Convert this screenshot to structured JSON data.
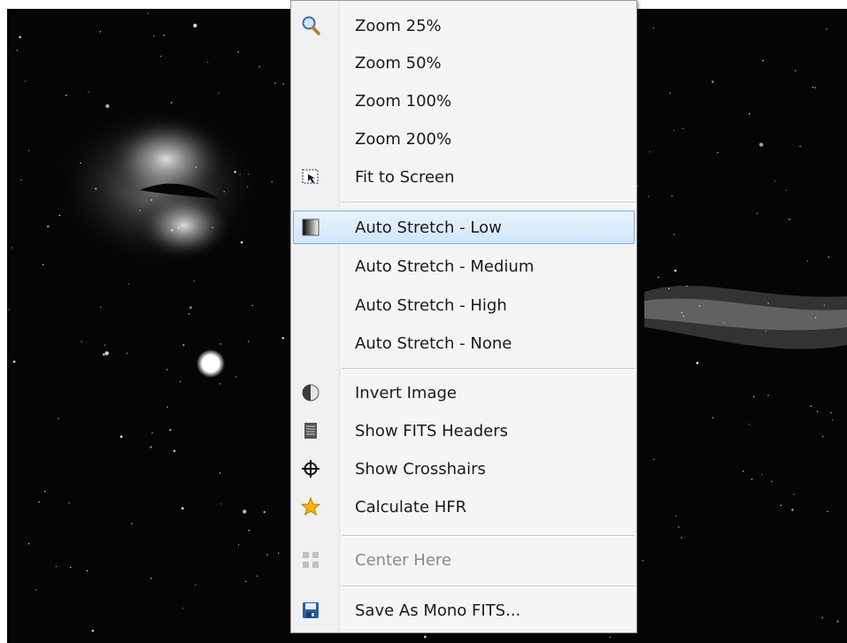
{
  "menu": {
    "items": [
      {
        "label": "Zoom 25%",
        "icon": "magnifier-icon"
      },
      {
        "label": "Zoom 50%",
        "icon": ""
      },
      {
        "label": "Zoom 100%",
        "icon": ""
      },
      {
        "label": "Zoom 200%",
        "icon": ""
      },
      {
        "label": "Fit to Screen",
        "icon": "fit-to-screen-icon"
      },
      {
        "label": "Auto Stretch - Low",
        "icon": "gradient-icon",
        "highlighted": true
      },
      {
        "label": "Auto Stretch - Medium",
        "icon": ""
      },
      {
        "label": "Auto Stretch - High",
        "icon": ""
      },
      {
        "label": "Auto Stretch - None",
        "icon": ""
      },
      {
        "label": "Invert Image",
        "icon": "half-circle-icon"
      },
      {
        "label": "Show FITS Headers",
        "icon": "document-icon"
      },
      {
        "label": "Show Crosshairs",
        "icon": "crosshair-icon"
      },
      {
        "label": "Calculate HFR",
        "icon": "star-icon"
      },
      {
        "label": "Center Here",
        "icon": "center-arrows-icon",
        "disabled": true
      },
      {
        "label": "Save As Mono FITS...",
        "icon": "floppy-disk-icon"
      }
    ]
  },
  "colors": {
    "highlight_border": "#7ab0e4",
    "highlight_fill": "#d0e6fb",
    "disabled_text": "#8a8a8a",
    "star_icon": "#f2b705",
    "floppy_icon": "#2b5fa8"
  }
}
